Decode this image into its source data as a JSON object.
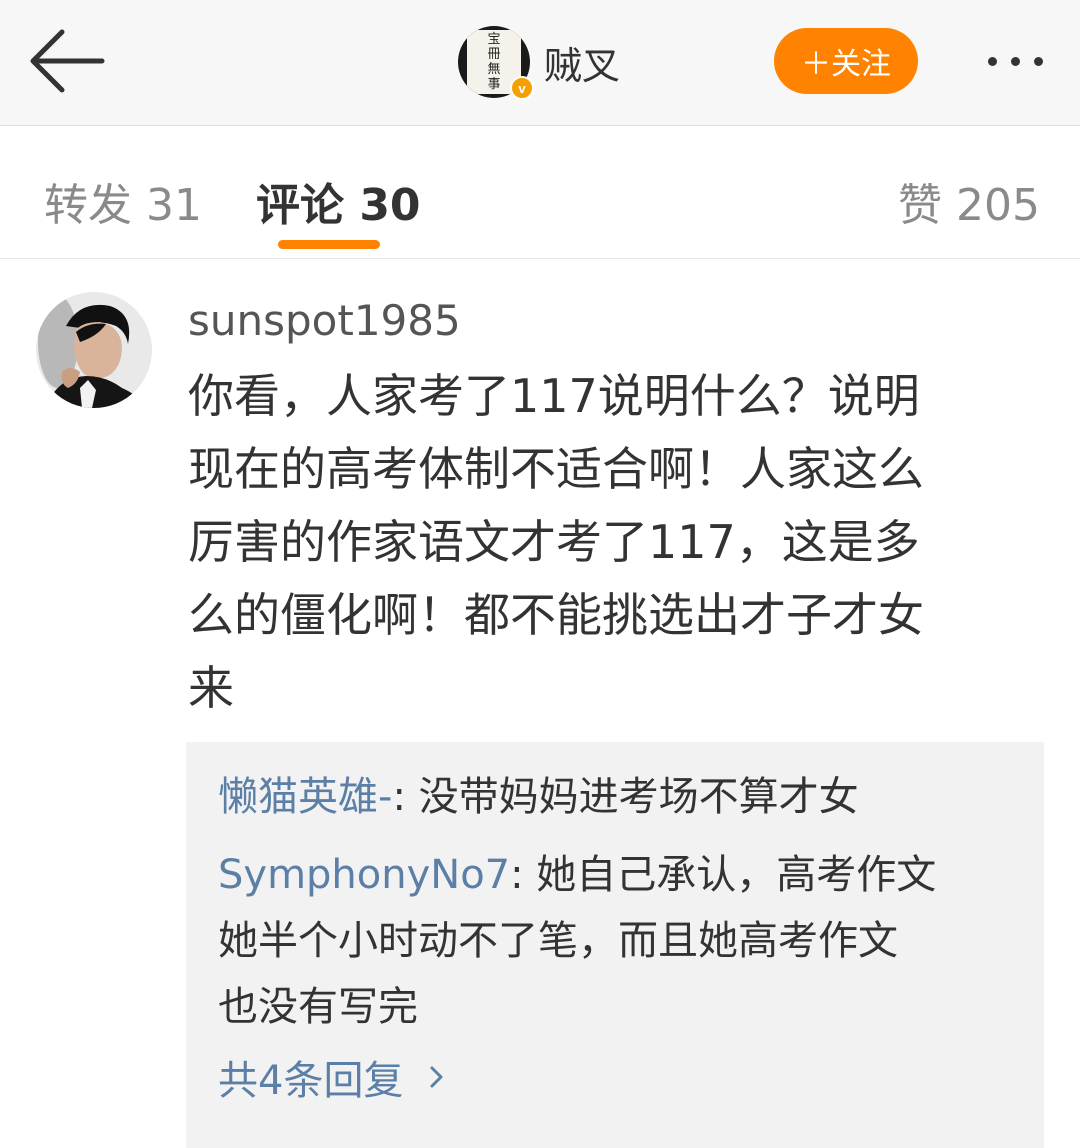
{
  "header": {
    "back_icon": "arrow-left-icon",
    "author_name": "贼叉",
    "author_avatar_text": [
      "宝",
      "冊",
      "無",
      "事"
    ],
    "verified_badge": "v",
    "follow_label": "＋关注",
    "more_icon": "more-dots-icon",
    "accent_color": "#ff8200"
  },
  "tabs": [
    {
      "label": "转发 31",
      "active": false
    },
    {
      "label": "评论 30",
      "active": true
    },
    {
      "label": "赞 205",
      "active": false
    }
  ],
  "comment": {
    "username": "sunspot1985",
    "lines": [
      "你看，人家考了117说明什么？说明",
      "现在的高考体制不适合啊！人家这么",
      "厉害的作家语文才考了117，这是多",
      "么的僵化啊！都不能挑选出才子才女",
      "来"
    ],
    "replies": [
      {
        "user": "懒猫英雄-",
        "lines": [
          ": 没带妈妈进考场不算才女"
        ]
      },
      {
        "user": "SymphonyNo7",
        "lines": [
          ": 她自己承认，高考作文",
          "她半个小时动不了笔，而且她高考作文",
          "也没有写完"
        ]
      }
    ],
    "more_replies_label": "共4条回复",
    "link_color": "#5b7fa6"
  }
}
